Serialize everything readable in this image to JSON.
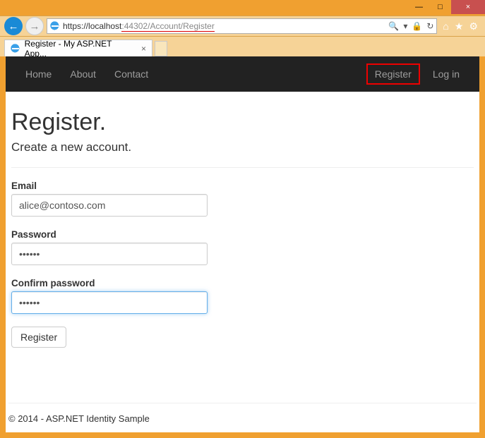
{
  "window": {
    "minimize": "—",
    "maximize": "□",
    "close": "×"
  },
  "browser": {
    "url_https": "https://",
    "url_host": "localhost",
    "url_port": ":44302",
    "url_path": "/Account/Register",
    "search_glyph": "🔍",
    "refresh_glyph": "↻",
    "lock_glyph": "🔒",
    "home_glyph": "⌂",
    "star_glyph": "★",
    "gear_glyph": "⚙",
    "back_glyph": "←",
    "fwd_glyph": "→",
    "tab_title": "Register - My ASP.NET App...",
    "tab_close": "×"
  },
  "nav": {
    "home": "Home",
    "about": "About",
    "contact": "Contact",
    "register": "Register",
    "login": "Log in"
  },
  "page": {
    "heading": "Register.",
    "subtitle": "Create a new account.",
    "email_label": "Email",
    "email_value": "alice@contoso.com",
    "password_label": "Password",
    "password_value": "••••••",
    "confirm_label": "Confirm password",
    "confirm_value": "••••••",
    "submit_label": "Register",
    "footer": "© 2014 - ASP.NET Identity Sample"
  }
}
